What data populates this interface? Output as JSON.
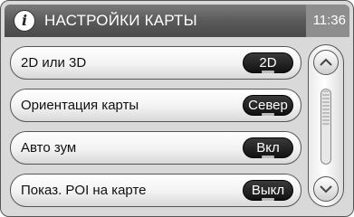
{
  "header": {
    "title": "НАСТРОЙКИ КАРТЫ",
    "time": "11:36",
    "icon": "info-icon"
  },
  "settings": [
    {
      "label": "2D или 3D",
      "value": "2D"
    },
    {
      "label": "Ориентация карты",
      "value": "Север"
    },
    {
      "label": "Авто зум",
      "value": "Вкл"
    },
    {
      "label": "Показ. POI на карте",
      "value": "Выкл"
    }
  ],
  "scrollbar": {
    "up_icon": "chevron-up-icon",
    "down_icon": "chevron-down-icon"
  }
}
